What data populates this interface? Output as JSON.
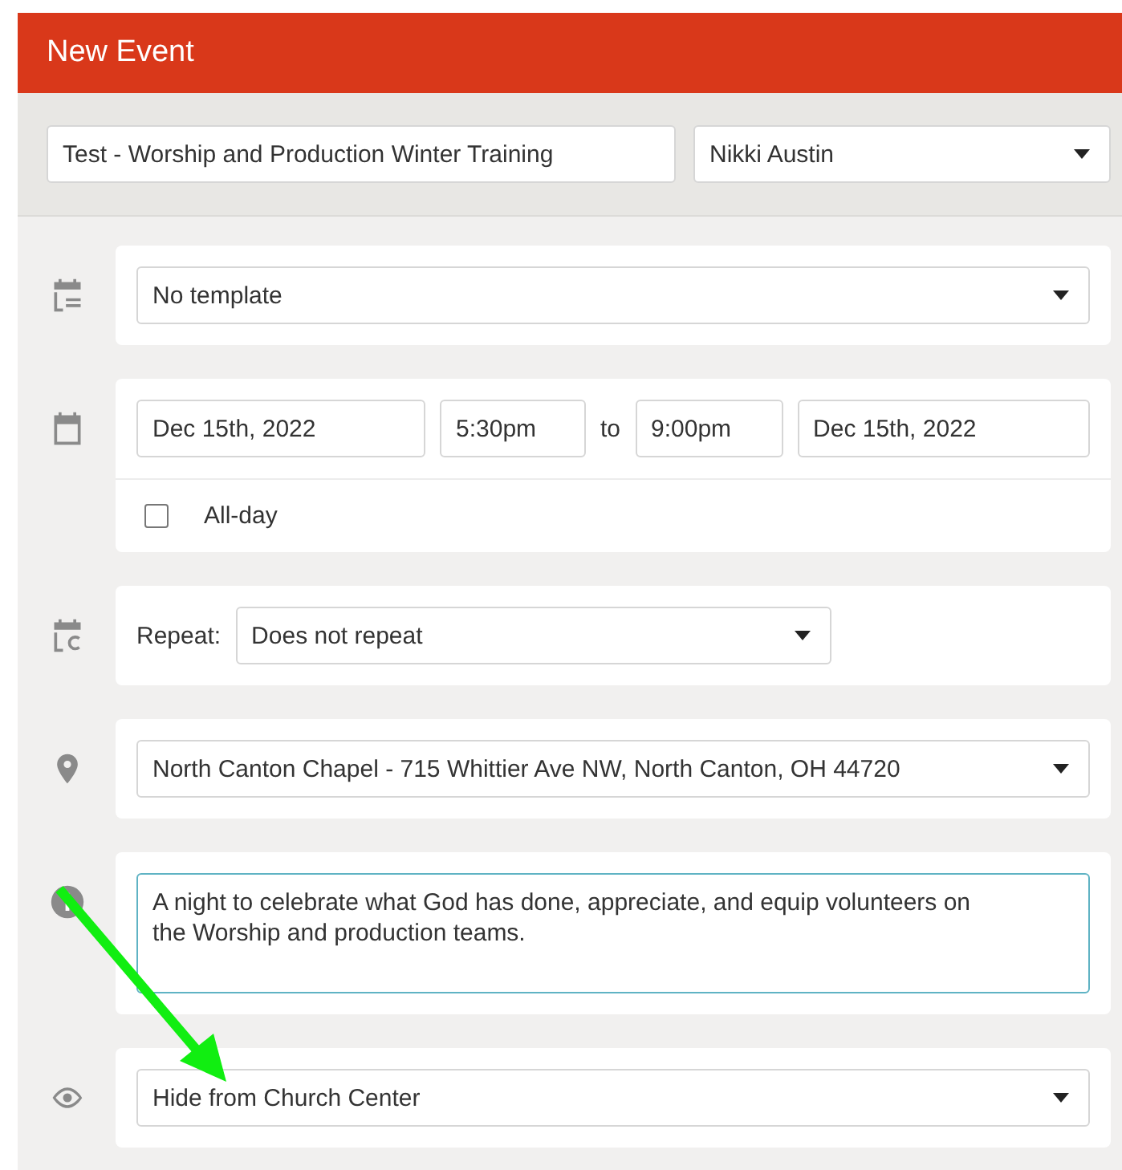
{
  "header": {
    "title": "New Event"
  },
  "title_field": {
    "value": "Test - Worship and Production Winter Training"
  },
  "owner_select": {
    "value": "Nikki Austin"
  },
  "sections": [
    {
      "kind": "select",
      "value": "No template"
    },
    {
      "kind": "datetime",
      "start_date": "Dec 15th, 2022",
      "start_time": "5:30pm",
      "separator": "to",
      "end_time": "9:00pm",
      "end_date": "Dec 15th, 2022",
      "all_day": {
        "label": "All-day",
        "checked": false
      }
    },
    {
      "kind": "repeat",
      "label": "Repeat:",
      "value": "Does not repeat"
    },
    {
      "kind": "select",
      "value": "North Canton Chapel - 715 Whittier Ave NW, North Canton, OH 44720"
    },
    {
      "kind": "textarea",
      "value": "A night to celebrate what God has done, appreciate, and equip volunteers on the Worship and production teams."
    },
    {
      "kind": "select",
      "value": "Hide from Church Center"
    }
  ]
}
